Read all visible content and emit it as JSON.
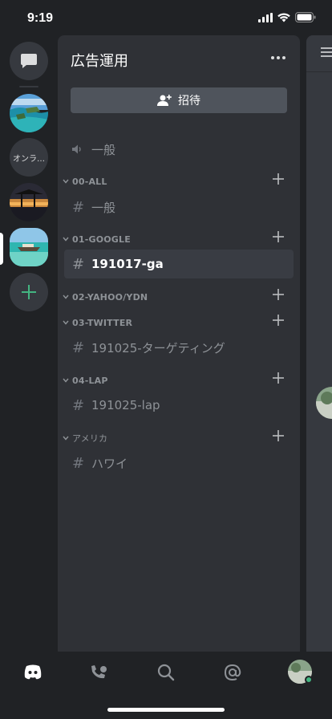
{
  "status_bar": {
    "time": "9:19"
  },
  "server_rail": {
    "online_server_label": "オンラ…",
    "accent_color": "#43b581"
  },
  "server": {
    "name": "広告運用",
    "invite_label": "招待"
  },
  "channels": {
    "top_voice": "一般",
    "categories": [
      {
        "name": "00-ALL",
        "channels": [
          "一般"
        ]
      },
      {
        "name": "01-GOOGLE",
        "channels": [
          "191017-ga"
        ]
      },
      {
        "name": "02-YAHOO/YDN",
        "channels": []
      },
      {
        "name": "03-TWITTER",
        "channels": [
          "191025-ターゲティング"
        ]
      },
      {
        "name": "04-LAP",
        "channels": [
          "191025-lap"
        ]
      },
      {
        "name": "アメリカ",
        "channels": [
          "ハワイ"
        ]
      }
    ],
    "selected": "191017-ga"
  },
  "bottom_nav": {
    "items": [
      "home-icon",
      "friends-icon",
      "search-icon",
      "mentions-icon",
      "profile-avatar"
    ],
    "status_color": "#43b581"
  }
}
